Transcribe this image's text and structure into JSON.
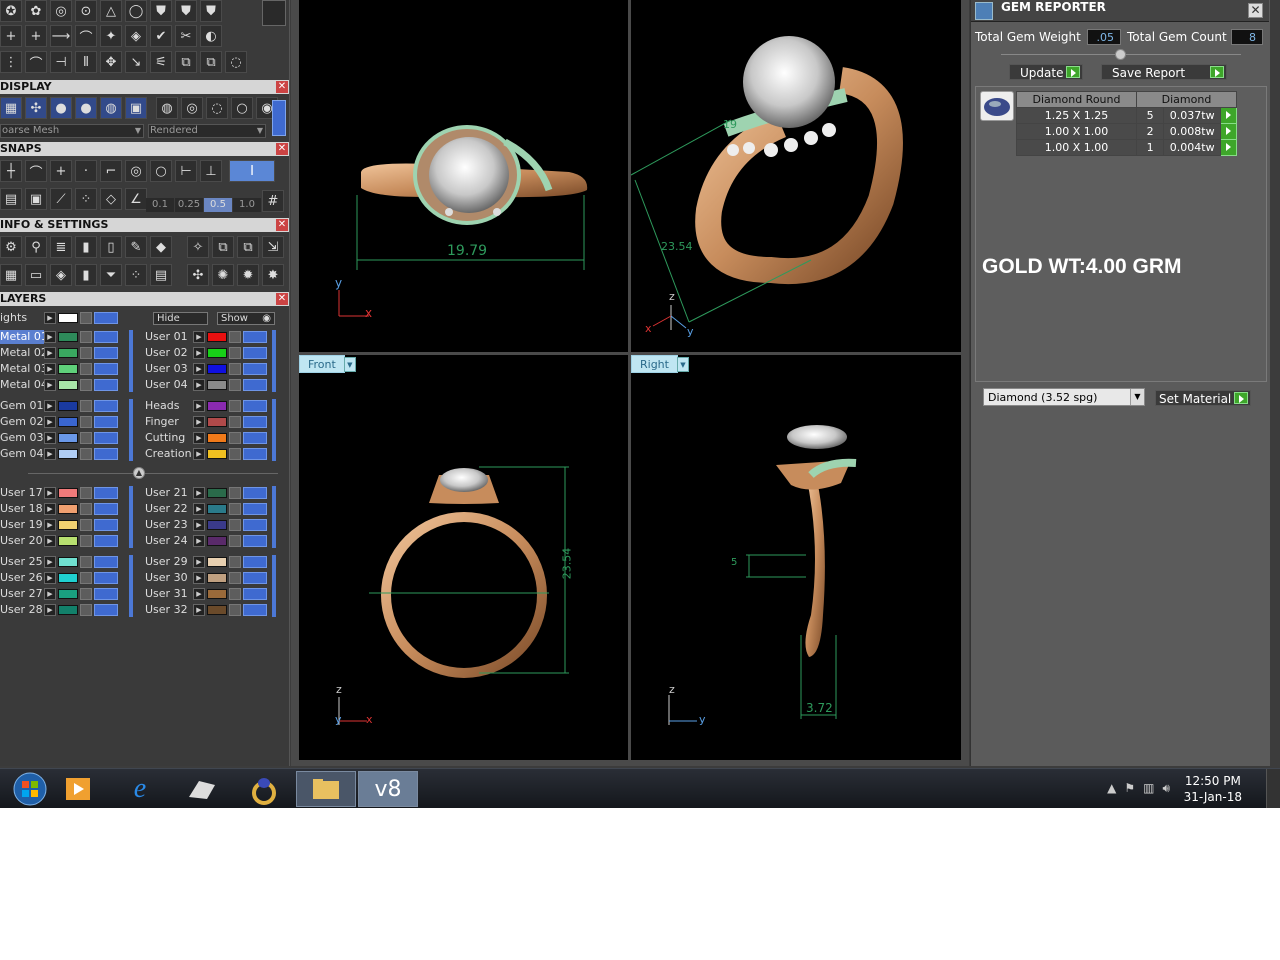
{
  "left_panel": {
    "toolbar_rows": [
      [
        "✪",
        "✿",
        "◎",
        "⊙",
        "△",
        "◯",
        "⛊",
        "⛊",
        "⛊"
      ],
      [
        "+",
        "+",
        "⟶",
        "⌒",
        "✦",
        "◈",
        "✔",
        "✂",
        "◐"
      ],
      [
        "⋮",
        "⌒",
        "⊣",
        "⫴",
        "✥",
        "↘",
        "⚟",
        "⧉",
        "⧉",
        "◌"
      ]
    ],
    "display": {
      "header": "DISPLAY",
      "mesh_select": "oarse Mesh",
      "render_select": "Rendered"
    },
    "snaps": {
      "header": "SNAPS",
      "values": [
        "0.1",
        "0.25",
        "0.5",
        "1.0"
      ]
    },
    "info": {
      "header": "INFO & SETTINGS"
    },
    "layers": {
      "header": "LAYERS",
      "lights_label": "ights",
      "hide_label": "Hide",
      "show_label": "Show",
      "left_group_1": [
        {
          "name": "Metal 01",
          "color": "#2e8a5a",
          "hl": true
        },
        {
          "name": "Metal 02",
          "color": "#3aa860",
          "hl": false
        },
        {
          "name": "Metal 03",
          "color": "#5fd07a",
          "hl": false
        },
        {
          "name": "Metal 04",
          "color": "#a8e6a8",
          "hl": false
        }
      ],
      "right_group_1": [
        {
          "name": "User 01",
          "color": "#e81010"
        },
        {
          "name": "User 02",
          "color": "#18d018"
        },
        {
          "name": "User 03",
          "color": "#1010e0"
        },
        {
          "name": "User 04",
          "color": "#8a8a8a"
        }
      ],
      "left_group_2": [
        {
          "name": "Gem 01",
          "color": "#1a3aa0"
        },
        {
          "name": "Gem 02",
          "color": "#3a66d0"
        },
        {
          "name": "Gem 03",
          "color": "#6a98e8"
        },
        {
          "name": "Gem 04",
          "color": "#b0cdf4"
        }
      ],
      "right_group_2": [
        {
          "name": "Heads",
          "color": "#8a2ab0"
        },
        {
          "name": "Finger",
          "color": "#b04a4a"
        },
        {
          "name": "Cutting",
          "color": "#f07a1a"
        },
        {
          "name": "Creation",
          "color": "#f0c020"
        }
      ],
      "left_group_3": [
        {
          "name": "User 17",
          "color": "#f07a7a"
        },
        {
          "name": "User 18",
          "color": "#f0a070"
        },
        {
          "name": "User 19",
          "color": "#f0d070"
        },
        {
          "name": "User 20",
          "color": "#b8e070"
        }
      ],
      "right_group_3": [
        {
          "name": "User 21",
          "color": "#2a6a4a"
        },
        {
          "name": "User 22",
          "color": "#2a7a8a"
        },
        {
          "name": "User 23",
          "color": "#3a3a8a"
        },
        {
          "name": "User 24",
          "color": "#5a2a6a"
        }
      ],
      "left_group_4": [
        {
          "name": "User 25",
          "color": "#70e0d0"
        },
        {
          "name": "User 26",
          "color": "#20d0d0"
        },
        {
          "name": "User 27",
          "color": "#1aa080"
        },
        {
          "name": "User 28",
          "color": "#12806a"
        }
      ],
      "right_group_4": [
        {
          "name": "User 29",
          "color": "#e8d0b0"
        },
        {
          "name": "User 30",
          "color": "#c0a080"
        },
        {
          "name": "User 31",
          "color": "#9a6a3a"
        },
        {
          "name": "User 32",
          "color": "#6a4a2a"
        }
      ]
    }
  },
  "viewports": {
    "top_left": {
      "dimension": "19.79",
      "axis_a": "y",
      "axis_b": "x"
    },
    "top_right": {
      "dim_a": "19",
      "dim_b": "23.54",
      "axis_a": "z",
      "axis_b": "x",
      "axis_c": "y"
    },
    "bottom_left": {
      "label": "Front",
      "dimension": "23.54",
      "axis_a": "z",
      "axis_b": "y",
      "axis_c": "x"
    },
    "bottom_right": {
      "label": "Right",
      "dim_a": "3.72",
      "dim_b": "5",
      "axis_a": "z",
      "axis_b": "y"
    }
  },
  "gem_reporter": {
    "title": "GEM REPORTER",
    "total_weight_label": "Total Gem Weight",
    "total_weight_value": ".05",
    "total_count_label": "Total Gem Count",
    "total_count_value": "8",
    "update_label": "Update",
    "save_label": "Save Report",
    "table": {
      "col1": "Diamond Round",
      "col2": "Diamond",
      "rows": [
        {
          "size": "1.25 X 1.25",
          "count": "5",
          "weight": "0.037tw"
        },
        {
          "size": "1.00 X 1.00",
          "count": "2",
          "weight": "0.008tw"
        },
        {
          "size": "1.00 X 1.00",
          "count": "1",
          "weight": "0.004tw"
        }
      ]
    },
    "gold_weight": "GOLD WT:4.00 GRM",
    "material": "Diamond     (3.52 spg)",
    "set_material_label": "Set Material"
  },
  "taskbar": {
    "apps": [
      "start-orb",
      "media-player",
      "internet-explorer",
      "rhino",
      "matrix-ring",
      "file-explorer",
      "v8"
    ],
    "v8_label": "v8",
    "time": "12:50 PM",
    "date": "31-Jan-18"
  }
}
